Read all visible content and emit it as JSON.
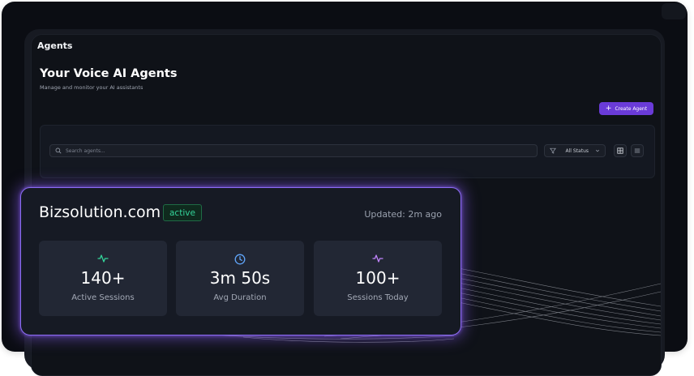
{
  "page": {
    "tab_title": "Agents",
    "title": "Your Voice AI Agents",
    "subtitle": "Manage and monitor your AI assistants"
  },
  "toolbar": {
    "create_label": "Create Agent",
    "create_icon": "plus-icon",
    "search_placeholder": "Search agents...",
    "search_icon": "search-icon",
    "status_filter_value": "All Status",
    "status_filter_icon": "filter-icon",
    "view_options": [
      "grid-view-icon",
      "list-view-icon"
    ]
  },
  "agent_card": {
    "name": "Bizsolution.com",
    "status": "active",
    "updated": "Updated: 2m ago",
    "stats": [
      {
        "value": "140+",
        "label": "Active Sessions",
        "icon": "activity-icon",
        "color": "#34d399"
      },
      {
        "value": "3m 50s",
        "label": "Avg Duration",
        "icon": "clock-icon",
        "color": "#60a5fa"
      },
      {
        "value": "100+",
        "label": "Sessions Today",
        "icon": "activity-icon",
        "color": "#c084fc"
      }
    ]
  },
  "colors": {
    "accent": "#6a3bd8",
    "card_glow": "#8b5cf6",
    "active_badge": "#34d399",
    "background": "#0f1218"
  }
}
